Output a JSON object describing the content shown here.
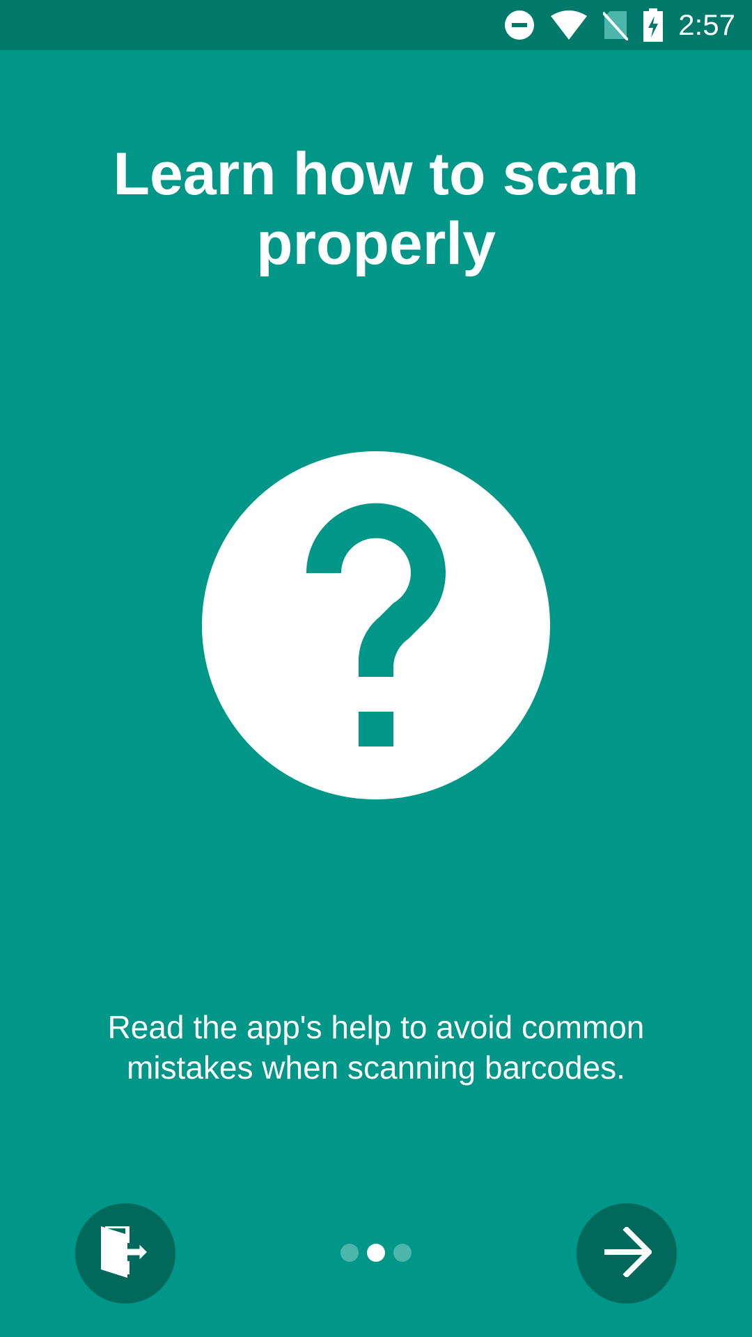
{
  "status_bar": {
    "time": "2:57",
    "icons": [
      "do-not-disturb-icon",
      "wifi-icon",
      "no-sim-icon",
      "battery-charging-icon"
    ]
  },
  "onboarding": {
    "title": "Learn how to scan properly",
    "illustration_icon": "help-circle-icon",
    "description": "Read the app's help to avoid common mistakes when scanning barcodes.",
    "page_indicator": {
      "total": 3,
      "current": 2
    },
    "skip_icon": "exit-door-icon",
    "next_icon": "arrow-forward-icon"
  },
  "colors": {
    "background": "#009688",
    "status_bar": "#00796B",
    "fab": "#00695C",
    "dot_inactive": "#4DB6AC",
    "foreground": "#FFFFFF"
  }
}
